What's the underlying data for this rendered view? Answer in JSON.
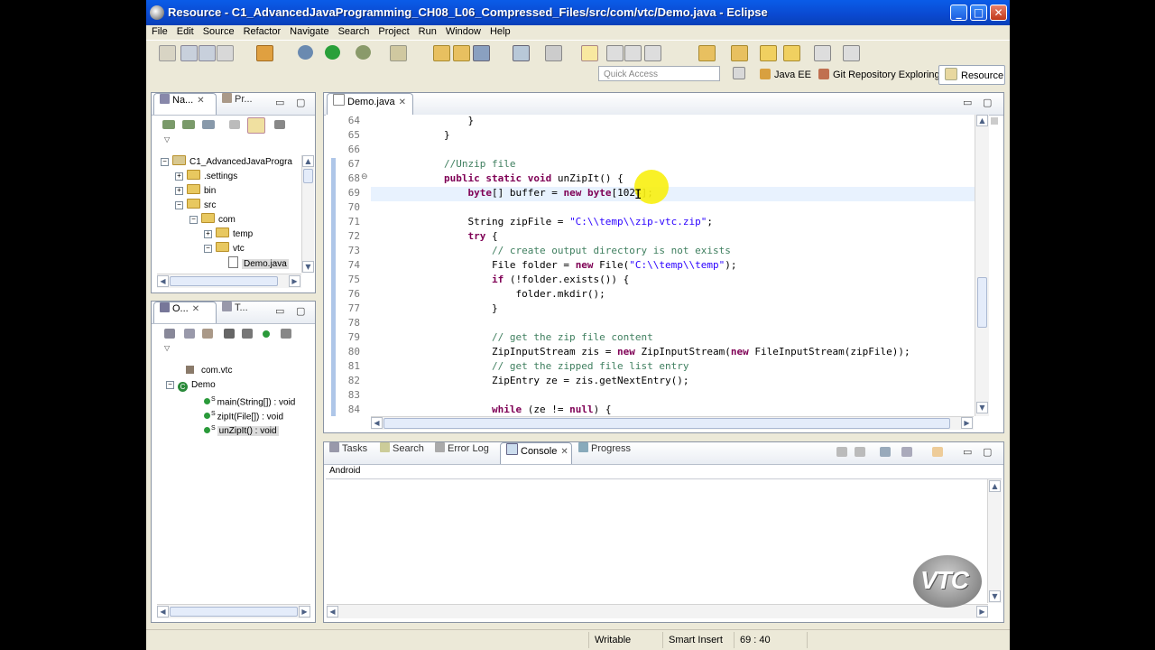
{
  "window": {
    "title": "Resource - C1_AdvancedJavaProgramming_CH08_L06_Compressed_Files/src/com/vtc/Demo.java - Eclipse",
    "minimize": "_",
    "maximize": "□",
    "close": "✕"
  },
  "menu": [
    "File",
    "Edit",
    "Source",
    "Refactor",
    "Navigate",
    "Search",
    "Project",
    "Run",
    "Window",
    "Help"
  ],
  "quick_access": {
    "placeholder": "Quick Access"
  },
  "perspectives": [
    {
      "label": "Java EE"
    },
    {
      "label": "Git Repository Exploring"
    },
    {
      "label": "Resource"
    }
  ],
  "navigator": {
    "tabs": [
      {
        "label": "Na..."
      },
      {
        "label": "Pr..."
      }
    ],
    "tree": [
      {
        "label": "C1_AdvancedJavaProgra",
        "depth": 0,
        "expander": "−"
      },
      {
        "label": ".settings",
        "depth": 1,
        "expander": "+"
      },
      {
        "label": "bin",
        "depth": 1,
        "expander": "+"
      },
      {
        "label": "src",
        "depth": 1,
        "expander": "−"
      },
      {
        "label": "com",
        "depth": 2,
        "expander": "−"
      },
      {
        "label": "temp",
        "depth": 3,
        "expander": "+"
      },
      {
        "label": "vtc",
        "depth": 3,
        "expander": "−"
      },
      {
        "label": "Demo.java",
        "depth": 4,
        "expander": ""
      }
    ]
  },
  "outline": {
    "tabs": [
      {
        "label": "O..."
      },
      {
        "label": "T..."
      }
    ],
    "items": [
      {
        "label": "com.vtc"
      },
      {
        "label": "Demo"
      },
      {
        "label": "main(String[]) : void",
        "sup": "S"
      },
      {
        "label": "zipIt(File[]) : void",
        "sup": "S"
      },
      {
        "label": "unZipIt() : void",
        "sup": "S"
      }
    ]
  },
  "editor": {
    "tab": "Demo.java",
    "lines": [
      {
        "n": "64",
        "code": "            }"
      },
      {
        "n": "65",
        "code": "        }"
      },
      {
        "n": "66",
        "code": ""
      },
      {
        "n": "67",
        "code": "        //Unzip file"
      },
      {
        "n": "68",
        "code": "        public static void unZipIt() {"
      },
      {
        "n": "69",
        "code": "            byte[] buffer = new byte[1024];"
      },
      {
        "n": "70",
        "code": ""
      },
      {
        "n": "71",
        "code": "            String zipFile = \"C:\\\\temp\\\\zip-vtc.zip\";"
      },
      {
        "n": "72",
        "code": "            try {"
      },
      {
        "n": "73",
        "code": "                // create output directory is not exists"
      },
      {
        "n": "74",
        "code": "                File folder = new File(\"C:\\\\temp\\\\temp\");"
      },
      {
        "n": "75",
        "code": "                if (!folder.exists()) {"
      },
      {
        "n": "76",
        "code": "                    folder.mkdir();"
      },
      {
        "n": "77",
        "code": "                }"
      },
      {
        "n": "78",
        "code": ""
      },
      {
        "n": "79",
        "code": "                // get the zip file content"
      },
      {
        "n": "80",
        "code": "                ZipInputStream zis = new ZipInputStream(new FileInputStream(zipFile));"
      },
      {
        "n": "81",
        "code": "                // get the zipped file list entry"
      },
      {
        "n": "82",
        "code": "                ZipEntry ze = zis.getNextEntry();"
      },
      {
        "n": "83",
        "code": ""
      },
      {
        "n": "84",
        "code": "                while (ze != null) {"
      }
    ]
  },
  "console": {
    "tabs": [
      {
        "label": "Tasks"
      },
      {
        "label": "Search"
      },
      {
        "label": "Error Log"
      },
      {
        "label": "Console"
      },
      {
        "label": "Progress"
      }
    ],
    "content": "Android"
  },
  "status": {
    "mode": "Writable",
    "insert": "Smart Insert",
    "position": "69 : 40"
  },
  "watermark": "VTC"
}
